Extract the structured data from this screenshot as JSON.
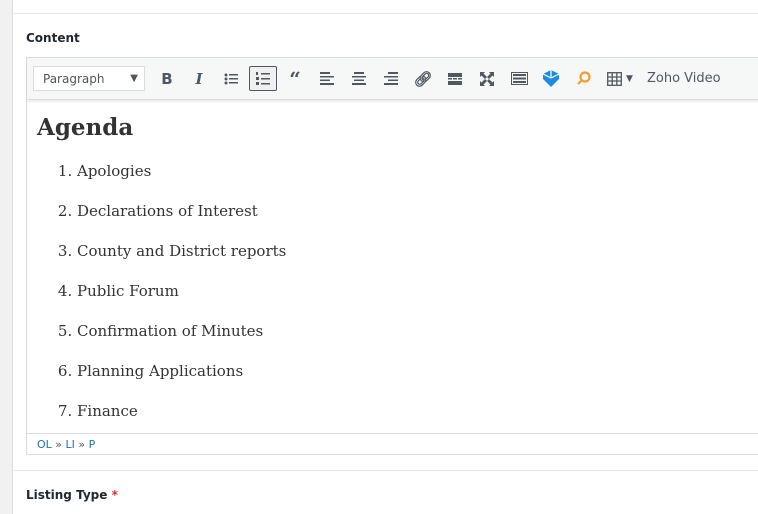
{
  "content_label": "Content",
  "toolbar": {
    "format_select": "Paragraph",
    "buttons": [
      "bold",
      "italic",
      "bulleted-list",
      "numbered-list",
      "blockquote",
      "align-left",
      "align-center",
      "align-right",
      "link",
      "read-more",
      "fullscreen",
      "keyboard",
      "hexagon-plugin",
      "search-plugin",
      "table"
    ],
    "zoho_video": "Zoho Video"
  },
  "document": {
    "heading": "Agenda",
    "items": [
      "Apologies",
      "Declarations of Interest",
      "County and District reports",
      "Public Forum",
      "Confirmation of Minutes",
      "Planning Applications",
      "Finance"
    ]
  },
  "status_path": {
    "ol": "OL",
    "li": "LI",
    "p": "P",
    "sep": "»"
  },
  "listing_type": {
    "label": "Listing Type",
    "required": "*"
  }
}
